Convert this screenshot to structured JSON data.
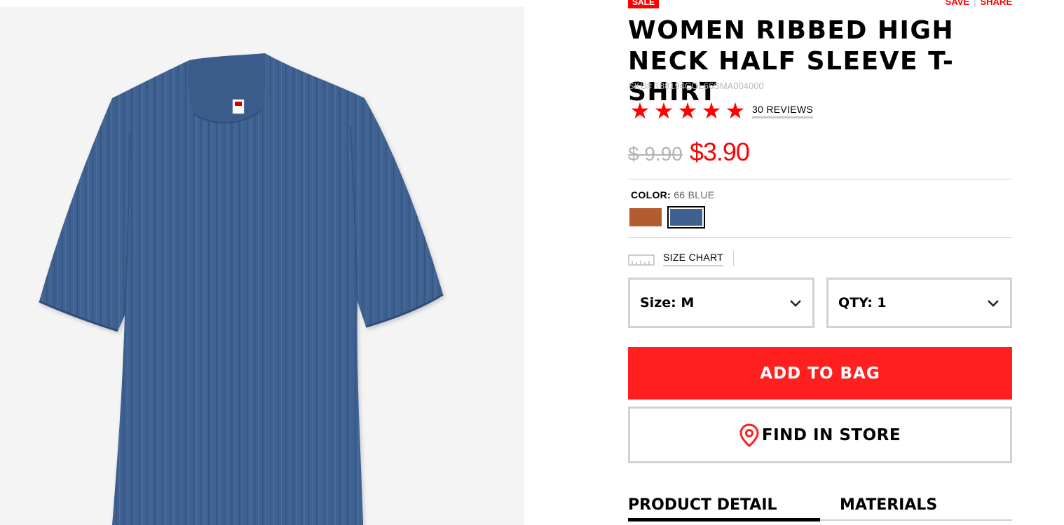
{
  "product": {
    "badge": "SALE",
    "title": "WOMEN RIBBED HIGH NECK HALF SLEEVE T-SHIRT",
    "sku": "SKU# 188194COL66SMA004000",
    "rating": 5,
    "reviews_label": "30 REVIEWS",
    "price_original": "$ 9.90",
    "price_sale": "$3.90",
    "image_icon": "tshirt-image"
  },
  "top_actions": {
    "save_label": "SAVE",
    "share_label": "SHARE",
    "separator": "|"
  },
  "color": {
    "label": "COLOR:",
    "value": "66 BLUE",
    "swatches": [
      {
        "name": "brown",
        "color": "#b35c30",
        "selected": false
      },
      {
        "name": "blue",
        "color": "#3e6190",
        "selected": true
      }
    ]
  },
  "size_chart": {
    "label": "SIZE CHART",
    "icon": "ruler-icon"
  },
  "selectors": {
    "size_label": "Size: M",
    "qty_label": "QTY: 1"
  },
  "buttons": {
    "add_to_bag": "ADD TO BAG",
    "find_in_store": "FIND IN STORE"
  },
  "tabs": [
    {
      "label": "PRODUCT DETAIL",
      "active": true
    },
    {
      "label": "MATERIALS",
      "active": false
    }
  ],
  "colors": {
    "accent": "#ff0000",
    "button_red": "#ff1f1f",
    "border_gray": "#d2d2d2",
    "shirt_blue": "#3e6190"
  }
}
